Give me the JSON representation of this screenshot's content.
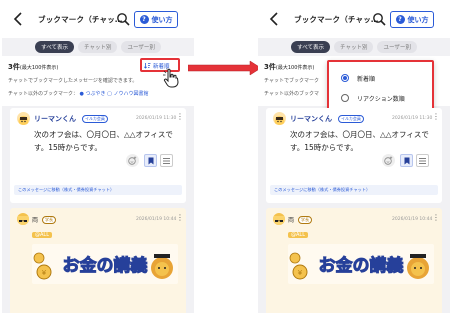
{
  "header": {
    "title": "ブックマーク（チャッ…",
    "title_right": "ブックマーク（チャッ…",
    "usage_label": "使い方"
  },
  "tabs": [
    {
      "label": "すべて表示",
      "active": true
    },
    {
      "label": "チャット別",
      "active": false
    },
    {
      "label": "ユーザー別",
      "active": false
    }
  ],
  "summary": {
    "count": "3件",
    "limit": "(最大100件表示)",
    "description": "チャットでブックマークしたメッセージを確認できます。",
    "description_right": "チャットでブックマーク",
    "other_prefix": "チャット以外のブックマーク：",
    "other_prefix_right": "チャット以外のブックマ",
    "link_posts": "つぶやき",
    "link_knowhow": "ノウハウ図書館",
    "sort_label": "新着順"
  },
  "sort_options": [
    {
      "label": "新着順",
      "selected": true
    },
    {
      "label": "リアクション数順",
      "selected": false
    }
  ],
  "messages": [
    {
      "user": "リーマンくん",
      "badge": "イルカ会員",
      "time": "2026/01/19 11:30",
      "text": "次のオフ会は、〇月〇日、△△オフィスです。15時からです。",
      "thread": "このメッセージに移動（株式・債券投資チャット）"
    },
    {
      "user": "両",
      "badge": "学長",
      "time": "2026/01/19 10:44",
      "tag": "@ALL",
      "banner": "お金の講義"
    }
  ],
  "colors": {
    "accent": "#2b5bd7",
    "highlight": "#e53238",
    "tag": "#f4c24d"
  }
}
